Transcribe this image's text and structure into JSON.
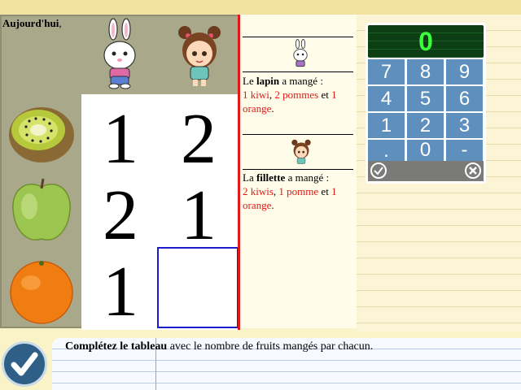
{
  "table": {
    "characters": [
      {
        "name": "lapin",
        "icon": "rabbit-icon"
      },
      {
        "name": "fillette",
        "icon": "girl-icon"
      }
    ],
    "fruits": [
      {
        "name": "kiwi",
        "icon": "kiwi-icon"
      },
      {
        "name": "pomme",
        "icon": "apple-icon"
      },
      {
        "name": "orange",
        "icon": "orange-icon"
      }
    ],
    "rows": [
      {
        "lapin": "1",
        "fillette": "2"
      },
      {
        "lapin": "2",
        "fillette": "1"
      },
      {
        "lapin": "1",
        "fillette": ""
      }
    ]
  },
  "story": {
    "title": "Aujourd'hui",
    "title_punct": ",",
    "lapin": {
      "prefix": "Le ",
      "subject": "lapin",
      "verb": " a mangé :",
      "item1": "1 kiwi",
      "sep1": ", ",
      "item2": "2 pommes",
      "sep2": " et ",
      "item3": "1 orange",
      "end": "."
    },
    "fillette": {
      "prefix": "La ",
      "subject": "fillette",
      "verb": " a mangé :",
      "item1": "2 kiwis",
      "sep1": ", ",
      "item2": "1 pomme",
      "sep2": " et ",
      "item3": "1 orange",
      "end": "."
    }
  },
  "keypad": {
    "display": "0",
    "keys": [
      "7",
      "8",
      "9",
      "4",
      "5",
      "6",
      "1",
      "2",
      "3",
      ".",
      "0",
      "-"
    ]
  },
  "instruction": {
    "bold": "Complétez le tableau",
    "rest": " avec le nombre de fruits mangés par chacun."
  },
  "colors": {
    "accent_red": "#e01818",
    "keypad_blue": "#5f8fbd",
    "display_green": "#3cff3c",
    "active_border": "#1c1cc8"
  }
}
